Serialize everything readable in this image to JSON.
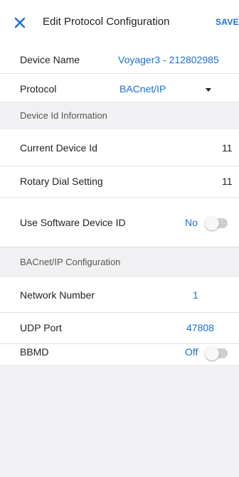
{
  "header": {
    "title": "Edit Protocol Configuration",
    "save_label": "SAVE",
    "close_icon": "close-icon"
  },
  "rows": {
    "device_name": {
      "label": "Device Name",
      "value": "Voyager3 - 212802985"
    },
    "protocol": {
      "label": "Protocol",
      "value": "BACnet/IP",
      "icon": "dropdown-caret-icon"
    }
  },
  "device_id_section": {
    "title": "Device Id Information",
    "current_device_id": {
      "label": "Current Device Id",
      "value": "11"
    },
    "rotary_dial": {
      "label": "Rotary Dial Setting",
      "value": "11"
    },
    "software_device_id": {
      "label": "Use Software Device ID",
      "value": "No",
      "toggle_on": false
    }
  },
  "bacnet_section": {
    "title": "BACnet/IP Configuration",
    "network_number": {
      "label": "Network Number",
      "value": "1"
    },
    "udp_port": {
      "label": "UDP Port",
      "value": "47808"
    },
    "bbmd": {
      "label": "BBMD",
      "value": "Off",
      "toggle_on": false
    }
  },
  "colors": {
    "accent": "#1a6fd6",
    "background": "#f4f4f6",
    "row_background": "#ffffff",
    "section_background": "#f1f1f3"
  }
}
